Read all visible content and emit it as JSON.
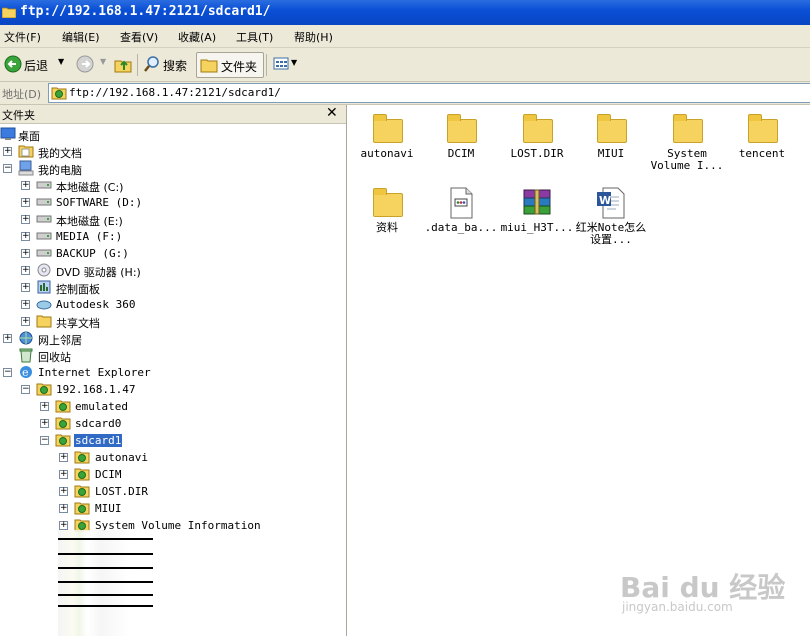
{
  "window": {
    "title": "ftp://192.168.1.47:2121/sdcard1/"
  },
  "menu": [
    "文件(F)",
    "编辑(E)",
    "查看(V)",
    "收藏(A)",
    "工具(T)",
    "帮助(H)"
  ],
  "toolbar": {
    "back": "后退",
    "search": "搜索",
    "folders": "文件夹"
  },
  "address": {
    "label": "地址(D)",
    "value": "ftp://192.168.1.47:2121/sdcard1/"
  },
  "tree": {
    "header": "文件夹",
    "close": "✕",
    "items": [
      {
        "label": "桌面"
      },
      {
        "label": "我的文档"
      },
      {
        "label": "我的电脑"
      },
      {
        "label": "本地磁盘 (C:)"
      },
      {
        "label": "SOFTWARE (D:)"
      },
      {
        "label": "本地磁盘 (E:)"
      },
      {
        "label": "MEDIA (F:)"
      },
      {
        "label": "BACKUP (G:)"
      },
      {
        "label": "DVD 驱动器 (H:)"
      },
      {
        "label": "控制面板"
      },
      {
        "label": "Autodesk 360"
      },
      {
        "label": "共享文档"
      },
      {
        "label": "网上邻居"
      },
      {
        "label": "回收站"
      },
      {
        "label": "Internet Explorer"
      },
      {
        "label": "192.168.1.47"
      },
      {
        "label": "emulated"
      },
      {
        "label": "sdcard0"
      },
      {
        "label": "sdcard1"
      },
      {
        "label": "autonavi"
      },
      {
        "label": "DCIM"
      },
      {
        "label": "LOST.DIR"
      },
      {
        "label": "MIUI"
      },
      {
        "label": "System Volume Information"
      }
    ]
  },
  "files": [
    {
      "name": "autonavi",
      "icon": "folder-icon"
    },
    {
      "name": "DCIM",
      "icon": "folder-icon"
    },
    {
      "name": "LOST.DIR",
      "icon": "folder-icon"
    },
    {
      "name": "MIUI",
      "icon": "folder-icon"
    },
    {
      "name": "System Volume I...",
      "icon": "folder-icon"
    },
    {
      "name": "tencent",
      "icon": "folder-icon"
    },
    {
      "name": "资料",
      "icon": "folder-icon"
    },
    {
      "name": ".data_ba...",
      "icon": "document-icon"
    },
    {
      "name": "miui_H3T...",
      "icon": "archive-icon"
    },
    {
      "name": "红米Note怎么设置...",
      "icon": "word-icon"
    }
  ],
  "watermark": {
    "brand": "Bai du 经验",
    "url": "jingyan.baidu.com"
  },
  "colors": {
    "titlebar": "#0a4fd6",
    "selection": "#316ac5",
    "chrome": "#ece9d8"
  }
}
